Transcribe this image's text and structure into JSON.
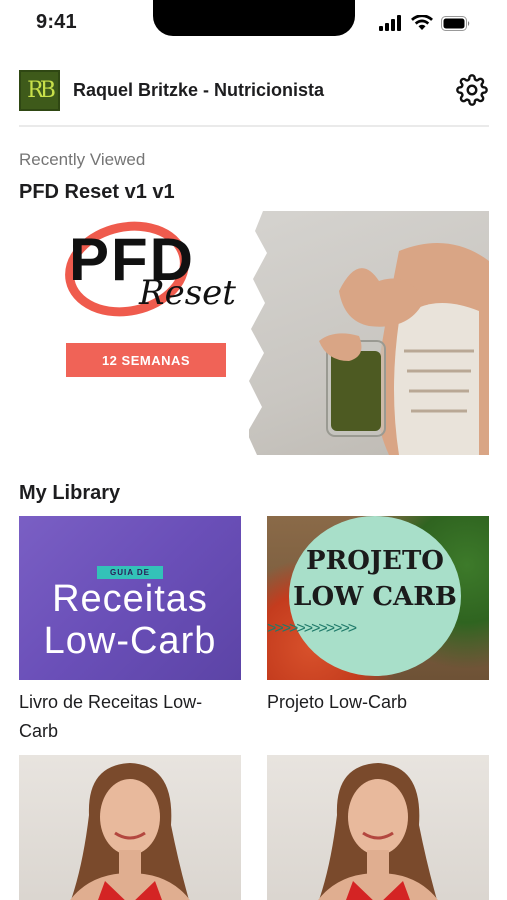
{
  "status_bar": {
    "time": "9:41"
  },
  "header": {
    "logo_text": "RB",
    "title": "Raquel Britzke - Nutricionista"
  },
  "recently_viewed": {
    "section_label": "Recently Viewed",
    "title": "PFD Reset v1 v1",
    "hero": {
      "brand": "PFD",
      "script": "Reset",
      "badge": "12 SEMANAS"
    }
  },
  "library": {
    "title": "My Library",
    "items": [
      {
        "label": "Livro de Receitas Low-Carb",
        "thumb_tag": "GUIA DE",
        "thumb_line1": "Receitas",
        "thumb_line2": "Low-Carb"
      },
      {
        "label": "Projeto Low-Carb",
        "thumb_line1": "PROJETO",
        "thumb_line2": "LOW CARB",
        "thumb_arrows": ">>>>>>>>>>>>"
      },
      {
        "label": ""
      },
      {
        "label": ""
      }
    ]
  },
  "colors": {
    "accent": "#f06357",
    "purple": "#6a4fb8",
    "mint": "#a8dfc9",
    "logo_bg": "#3e5a1a"
  }
}
